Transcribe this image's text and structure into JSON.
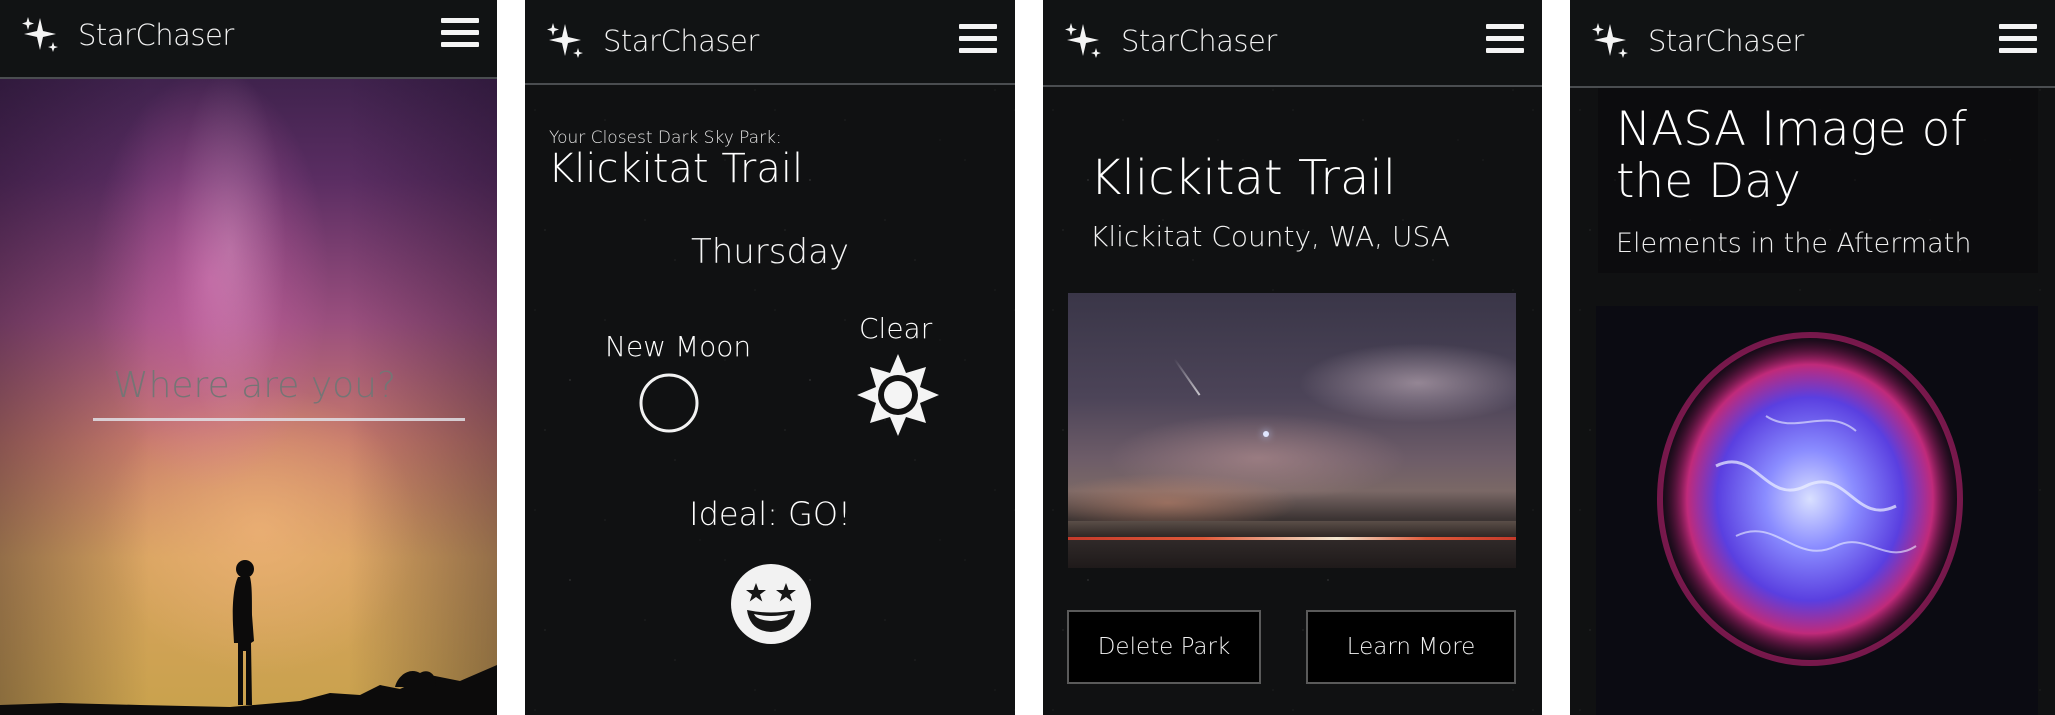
{
  "app": {
    "brand": "StarChaser"
  },
  "icons": {
    "logo": "sparkles-icon",
    "menu": "hamburger-menu-icon",
    "moon": "new-moon-circle-icon",
    "weather": "sun-icon",
    "status": "star-eyes-smiley-icon"
  },
  "screen1": {
    "search_placeholder": "Where are you?"
  },
  "screen2": {
    "closest_label": "Your Closest Dark Sky Park:",
    "park_name": "Klickitat Trail",
    "day": "Thursday",
    "moon_phase": "New Moon",
    "weather": "Clear",
    "ideal": "Ideal: GO!"
  },
  "screen3": {
    "park_name": "Klickitat Trail",
    "location": "Klickitat County, WA, USA",
    "delete_label": "Delete Park",
    "learn_label": "Learn More"
  },
  "screen4": {
    "title": "NASA Image of the Day",
    "subtitle": "Elements in the Aftermath"
  },
  "colors": {
    "header_bg": "#111314",
    "screen_bg": "#101112",
    "text": "#ffffff",
    "button_border": "#5a5a5a"
  }
}
